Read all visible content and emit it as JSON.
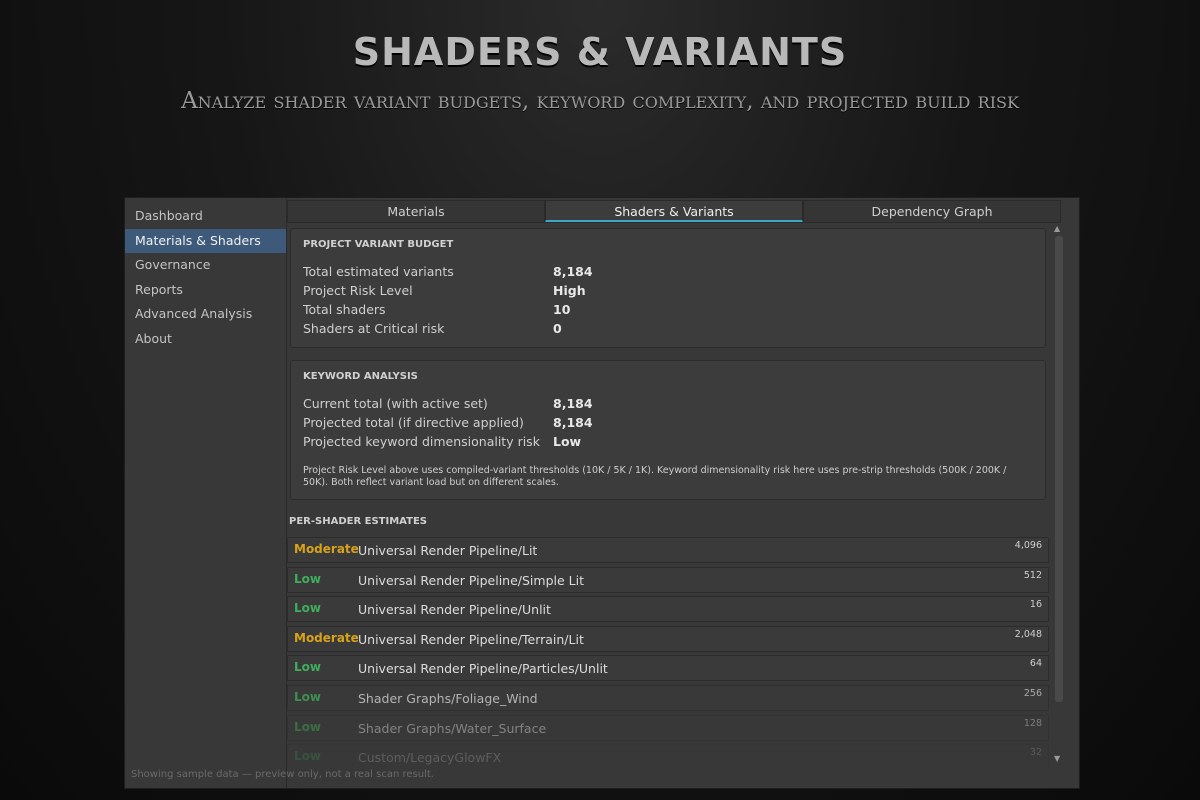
{
  "hero": {
    "title": "SHADERS & VARIANTS",
    "subtitle": "Analyze shader variant budgets, keyword complexity, and projected build risk"
  },
  "sidebar": {
    "items": [
      {
        "label": "Dashboard"
      },
      {
        "label": "Materials & Shaders",
        "active": true
      },
      {
        "label": "Governance"
      },
      {
        "label": "Reports"
      },
      {
        "label": "Advanced Analysis"
      },
      {
        "label": "About"
      }
    ]
  },
  "tabs": [
    {
      "label": "Materials"
    },
    {
      "label": "Shaders & Variants",
      "active": true
    },
    {
      "label": "Dependency Graph"
    }
  ],
  "budget": {
    "title": "PROJECT VARIANT BUDGET",
    "rows": [
      {
        "label": "Total estimated variants",
        "value": "8,184"
      },
      {
        "label": "Project Risk Level",
        "value": "High"
      },
      {
        "label": "Total shaders",
        "value": "10"
      },
      {
        "label": "Shaders at Critical risk",
        "value": "0"
      }
    ]
  },
  "keywords": {
    "title": "KEYWORD ANALYSIS",
    "rows": [
      {
        "label": "Current total (with active set)",
        "value": "8,184"
      },
      {
        "label": "Projected total (if directive applied)",
        "value": "8,184"
      },
      {
        "label": "Projected keyword dimensionality risk",
        "value": "Low"
      }
    ],
    "note": "Project Risk Level above uses compiled-variant thresholds (10K / 5K / 1K). Keyword dimensionality risk here uses pre-strip thresholds (500K / 200K / 50K). Both reflect variant load but on different scales."
  },
  "per_shader": {
    "title": "PER-SHADER ESTIMATES",
    "rows": [
      {
        "risk": "Moderate",
        "name": "Universal Render Pipeline/Lit",
        "count": "4,096"
      },
      {
        "risk": "Low",
        "name": "Universal Render Pipeline/Simple Lit",
        "count": "512"
      },
      {
        "risk": "Low",
        "name": "Universal Render Pipeline/Unlit",
        "count": "16"
      },
      {
        "risk": "Moderate",
        "name": "Universal Render Pipeline/Terrain/Lit",
        "count": "2,048"
      },
      {
        "risk": "Low",
        "name": "Universal Render Pipeline/Particles/Unlit",
        "count": "64"
      },
      {
        "risk": "Low",
        "name": "Shader Graphs/Foliage_Wind",
        "count": "256"
      },
      {
        "risk": "Low",
        "name": "Shader Graphs/Water_Surface",
        "count": "128"
      },
      {
        "risk": "Low",
        "name": "Custom/LegacyGlowFX",
        "count": "32"
      }
    ]
  },
  "colors": {
    "moderate": "#d9a21b",
    "low": "#3fae5a",
    "accent": "#3aa7c4",
    "sidebar_active": "#3e5a7a"
  },
  "footer": {
    "note": "Showing sample data — preview only, not a real scan result."
  },
  "icons": {
    "scroll_up": "triangle-up-icon",
    "scroll_down": "triangle-down-icon"
  }
}
